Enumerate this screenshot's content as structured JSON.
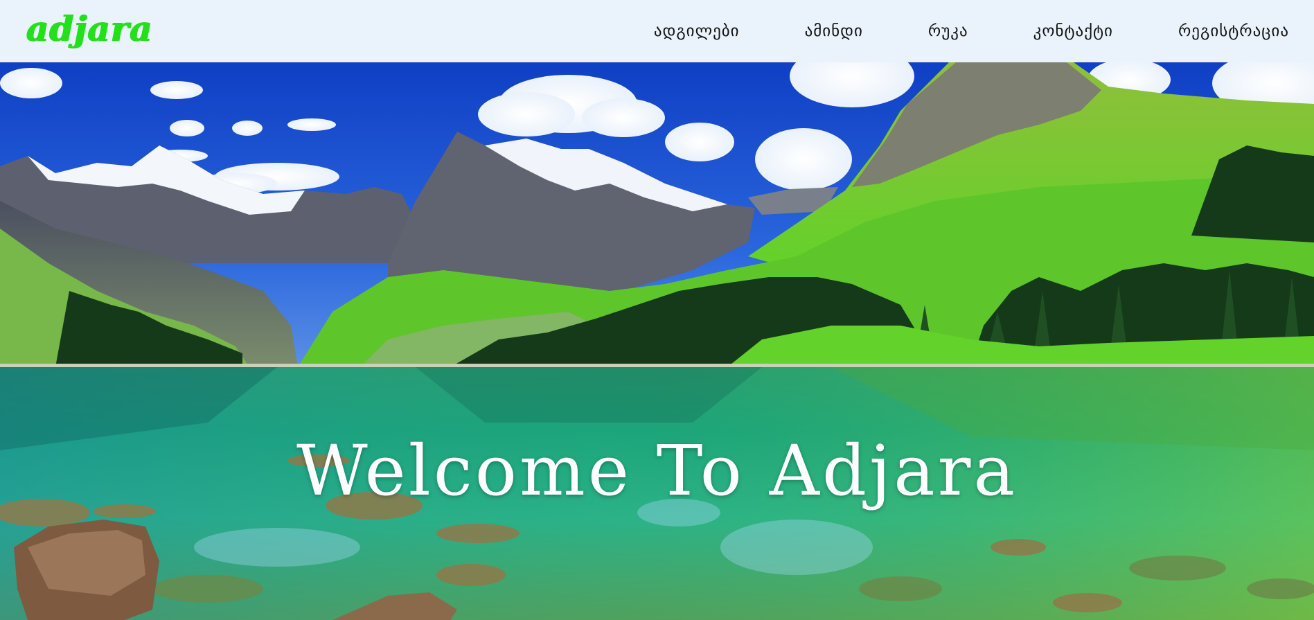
{
  "header": {
    "logo_text": "adjara",
    "logo_color": "#22e01a",
    "nav_items": [
      {
        "label": "ადგილები"
      },
      {
        "label": "ამინდი"
      },
      {
        "label": "რუკა"
      },
      {
        "label": "კონტაქტი"
      },
      {
        "label": "რეგისტრაცია"
      }
    ]
  },
  "hero": {
    "headline": "Welcome To Adjara",
    "background_description_colors": {
      "sky": "#1a4fd0",
      "lake": "#19a07a",
      "grass": "#5fcb2a"
    }
  }
}
